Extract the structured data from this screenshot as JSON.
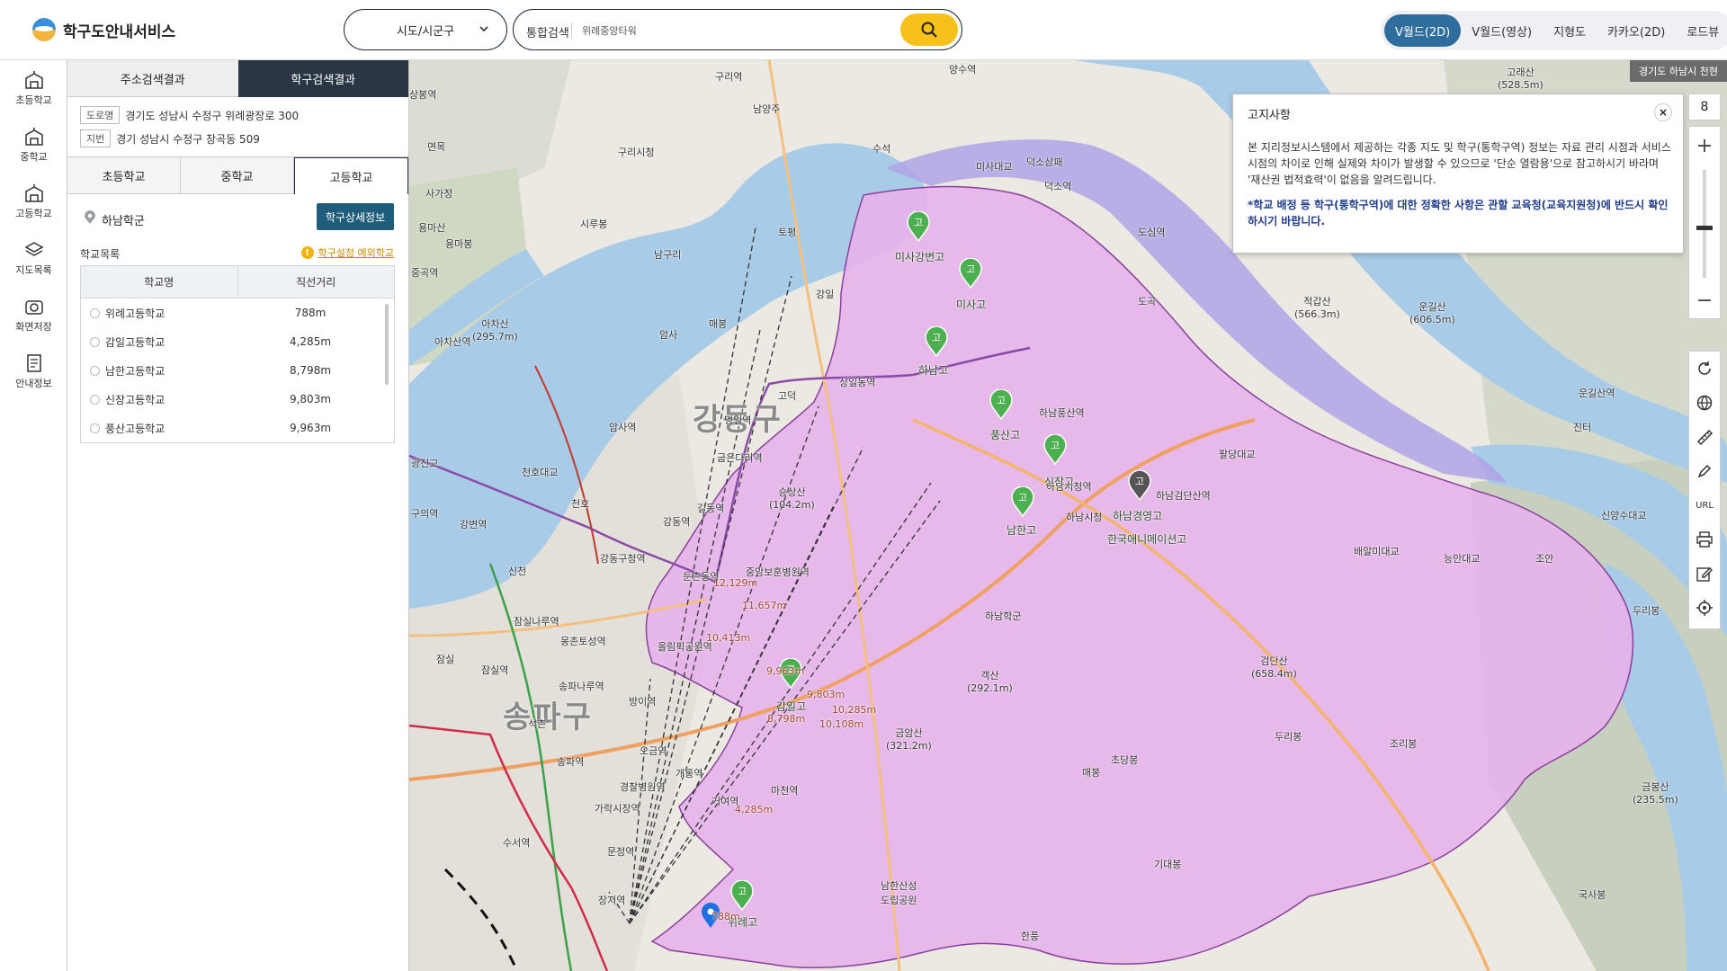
{
  "header": {
    "logo_text": "학구도안내서비스",
    "region_select": "시도/시군구",
    "search_type": "통합검색",
    "search_value": "위례중앙타워",
    "map_tabs": [
      {
        "label": "V월드(2D)",
        "active": true
      },
      {
        "label": "V월드(영상)",
        "active": false
      },
      {
        "label": "지형도",
        "active": false
      },
      {
        "label": "카카오(2D)",
        "active": false
      },
      {
        "label": "로드뷰",
        "active": false
      }
    ]
  },
  "leftnav": {
    "items": [
      {
        "label": "초등학교",
        "icon": "building-icon"
      },
      {
        "label": "중학교",
        "icon": "building-icon"
      },
      {
        "label": "고등학교",
        "icon": "building-icon"
      },
      {
        "label": "지도목록",
        "icon": "layers-icon"
      },
      {
        "label": "화면저장",
        "icon": "camera-icon"
      },
      {
        "label": "안내정보",
        "icon": "document-icon"
      }
    ]
  },
  "panel": {
    "result_tabs": [
      {
        "label": "주소검색결과",
        "active": false
      },
      {
        "label": "학구검색결과",
        "active": true
      }
    ],
    "address": {
      "road_tag": "도로명",
      "road": "경기도 성남시 수정구 위례광장로 300",
      "lot_tag": "지번",
      "lot": "경기 성남시 수정구 창곡동 509"
    },
    "level_tabs": [
      {
        "label": "초등학교",
        "active": false
      },
      {
        "label": "중학교",
        "active": false
      },
      {
        "label": "고등학교",
        "active": true
      }
    ],
    "district_name": "하남학군",
    "detail_button": "학구상세정보",
    "list_title": "학교목록",
    "notice_link": "학구설정 예외학교",
    "table": {
      "headers": [
        "학교명",
        "직선거리"
      ],
      "rows": [
        {
          "name": "위례고등학교",
          "distance": "788m"
        },
        {
          "name": "감일고등학교",
          "distance": "4,285m"
        },
        {
          "name": "남한고등학교",
          "distance": "8,798m"
        },
        {
          "name": "신장고등학교",
          "distance": "9,803m"
        },
        {
          "name": "풍산고등학교",
          "distance": "9,963m"
        }
      ]
    },
    "collapse": "‹"
  },
  "map": {
    "region_badge": "경기도 하남시 천현",
    "district_labels": [
      "강동구",
      "송파구"
    ],
    "place_labels": [
      "상봉역",
      "면목",
      "사가정",
      "용마산",
      "용마봉",
      "중곡역",
      "아차산역",
      "구리시청",
      "남양주",
      "구리역",
      "시루봉",
      "토평",
      "남구리",
      "강일",
      "암사",
      "매봉",
      "고덕",
      "상일동역",
      "암사역",
      "명일역",
      "굽은다리역",
      "길동역",
      "천호",
      "강동역",
      "강동구청역",
      "둔촌동역",
      "중앙보훈병원역",
      "잠실나루역",
      "몽촌토성역",
      "올림픽공원역",
      "송파나루역",
      "방이역",
      "석촌",
      "송파역",
      "오금역",
      "개롱역",
      "거여역",
      "마천역",
      "경찰병원역",
      "가락시장역",
      "문정역",
      "장지역",
      "수서역",
      "덕소삼패",
      "덕소역",
      "도심역",
      "도곡",
      "하남풍산역",
      "하남시청역",
      "하남검단산역",
      "하남시청",
      "하남학군",
      "적갑산\n(566.3m)",
      "운길산\n(606.5m)",
      "검단산\n(658.4m)",
      "객산\n(292.1m)",
      "금암산\n(321.2m)",
      "승상산\n(104.2m)",
      "아차산\n(295.7m)",
      "고래산\n(528.5m)",
      "두리봉",
      "조리봉",
      "기대봉",
      "초당봉",
      "매봉",
      "금봉산\n(235.5m)",
      "국사봉",
      "남한산성\n도립공원",
      "한풍",
      "조안",
      "능안대교",
      "진터",
      "두리봉",
      "팔당대교",
      "미사대교",
      "배알미대교",
      "신양수대교",
      "양수역",
      "운길산역",
      "수석",
      "잠실역",
      "잠실",
      "신천",
      "강변역",
      "구의역",
      "천호대교",
      "광진교"
    ],
    "school_labels": [
      "미사강변고",
      "미사고",
      "하남고",
      "풍산고",
      "신장고",
      "남한고",
      "감일고",
      "위례고",
      "하남경영고",
      "한국애니메이션고"
    ],
    "distance_labels": [
      "12,129m",
      "11,657m",
      "10,413m",
      "9,963m",
      "9,803m",
      "8,798m",
      "10,285m",
      "10,108m",
      "4,285m",
      "788m"
    ],
    "colors": {
      "district_fill": "#e6b3ea",
      "district_stroke": "#8a3f9e",
      "river": "#a8cbe8",
      "purple_zone": "#b1a3e8",
      "marker_green": "#4caf50",
      "marker_grey": "#555555",
      "pin_blue": "#1e6fe0"
    }
  },
  "notice": {
    "title": "고지사항",
    "close": "×",
    "body": "본 지리정보시스템에서 제공하는 각종 지도 및 학구(통학구역) 정보는 자료 관리 시점과 서비스 시점의 차이로 인해 실제와 차이가 발생할 수 있으므로 '단순 열람용'으로 참고하시기 바라며 '재산권 법적효력'이 없음을 알려드립니다.",
    "strong": "*학교 배정 등 학구(통학구역)에 대한 정확한 사항은 관할 교육청(교육지원청)에 반드시 확인하시기 바랍니다."
  },
  "tools": {
    "zoom_level": "8",
    "zoom_in": "+",
    "zoom_out": "−",
    "url_label": "URL"
  }
}
